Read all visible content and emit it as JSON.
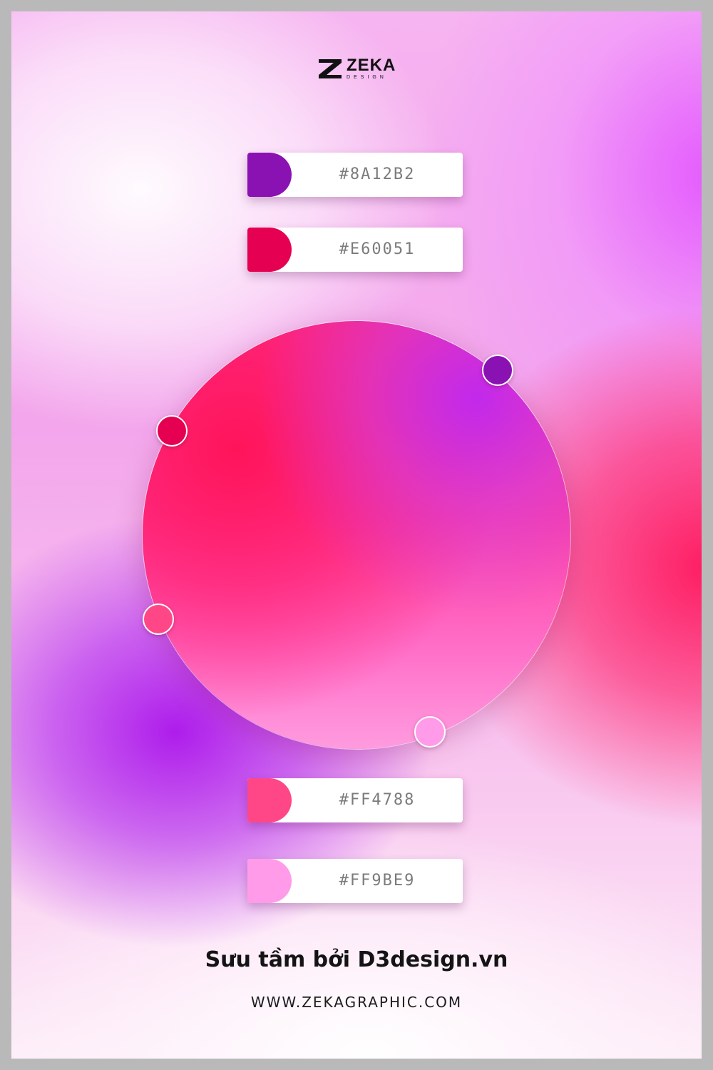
{
  "brand": {
    "name": "ZEKA",
    "sub": "DESIGN"
  },
  "palette": [
    {
      "hex": "#8A12B2",
      "color": "#8A12B2"
    },
    {
      "hex": "#E60051",
      "color": "#E60051"
    },
    {
      "hex": "#FF4788",
      "color": "#FF4788"
    },
    {
      "hex": "#FF9BE9",
      "color": "#FF9BE9"
    }
  ],
  "footer": {
    "caption": "Sưu tầm bởi D3design.vn",
    "website": "WWW.ZEKAGRAPHIC.COM"
  }
}
